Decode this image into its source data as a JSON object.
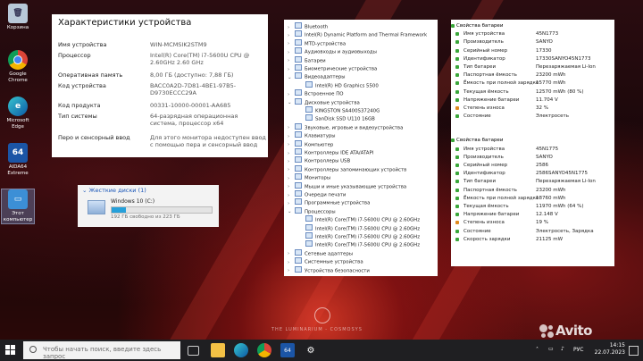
{
  "desktop": {
    "icons": [
      {
        "label": "Корзина"
      },
      {
        "label": "Google Chrome"
      },
      {
        "label": "Microsoft Edge"
      },
      {
        "label": "AIDA64 Extreme"
      },
      {
        "label": "Этот компьютер"
      }
    ],
    "wallpaper_caption": "THE LUMINARIUM - COSMOSYS"
  },
  "device_info": {
    "title": "Характеристики устройства",
    "rows": [
      {
        "key": "Имя устройства",
        "value": "WIN-MCMSIK2STM9"
      },
      {
        "key": "Процессор",
        "value": "Intel(R) Core(TM) i7-5600U CPU @ 2.60GHz   2.60 GHz"
      },
      {
        "key": "Оперативная память",
        "value": "8,00 ГБ (доступно: 7,88 ГБ)"
      },
      {
        "key": "Код устройства",
        "value": "BACC0A2D-7D81-4BE1-97B5-D9730ECCC29A"
      },
      {
        "key": "Код продукта",
        "value": "00331-10000-00001-AA685"
      },
      {
        "key": "Тип системы",
        "value": "64-разрядная операционная система, процессор x64"
      },
      {
        "key": "Перо и сенсорный ввод",
        "value": "Для этого монитора недоступен ввод с помощью пера и сенсорный ввод"
      }
    ]
  },
  "drives": {
    "header": "Жесткие диски (1)",
    "drive_name": "Windows 10 (C:)",
    "free_text": "192 ГБ свободно из 223 ГБ",
    "used_fraction": 0.14
  },
  "device_manager": {
    "items": [
      {
        "label": "Bluetooth",
        "level": 0
      },
      {
        "label": "Intel(R) Dynamic Platform and Thermal Framework",
        "level": 0
      },
      {
        "label": "MTD-устройства",
        "level": 0
      },
      {
        "label": "Аудиовходы и аудиовыходы",
        "level": 0
      },
      {
        "label": "Батареи",
        "level": 0
      },
      {
        "label": "Биометрические устройства",
        "level": 0
      },
      {
        "label": "Видеоадаптеры",
        "level": 0,
        "expanded": true
      },
      {
        "label": "Intel(R) HD Graphics 5500",
        "level": 1
      },
      {
        "label": "Встроенное ПО",
        "level": 0
      },
      {
        "label": "Дисковые устройства",
        "level": 0,
        "expanded": true
      },
      {
        "label": "KINGSTON SA400S37240G",
        "level": 1
      },
      {
        "label": "SanDisk SSD U110 16GB",
        "level": 1
      },
      {
        "label": "Звуковые, игровые и видеоустройства",
        "level": 0
      },
      {
        "label": "Клавиатуры",
        "level": 0
      },
      {
        "label": "Компьютер",
        "level": 0
      },
      {
        "label": "Контроллеры IDE ATA/ATAPI",
        "level": 0
      },
      {
        "label": "Контроллеры USB",
        "level": 0
      },
      {
        "label": "Контроллеры запоминающих устройств",
        "level": 0
      },
      {
        "label": "Мониторы",
        "level": 0
      },
      {
        "label": "Мыши и иные указывающие устройства",
        "level": 0
      },
      {
        "label": "Очереди печати",
        "level": 0
      },
      {
        "label": "Программные устройства",
        "level": 0
      },
      {
        "label": "Процессоры",
        "level": 0,
        "expanded": true
      },
      {
        "label": "Intel(R) Core(TM) i7-5600U CPU @ 2.60GHz",
        "level": 1
      },
      {
        "label": "Intel(R) Core(TM) i7-5600U CPU @ 2.60GHz",
        "level": 1
      },
      {
        "label": "Intel(R) Core(TM) i7-5600U CPU @ 2.60GHz",
        "level": 1
      },
      {
        "label": "Intel(R) Core(TM) i7-5600U CPU @ 2.60GHz",
        "level": 1
      },
      {
        "label": "Сетевые адаптеры",
        "level": 0
      },
      {
        "label": "Системные устройства",
        "level": 0
      },
      {
        "label": "Устройства безопасности",
        "level": 0
      }
    ]
  },
  "battery": {
    "groups": [
      {
        "header": "Свойства батареи",
        "rows": [
          {
            "key": "Имя устройства",
            "value": "45N1773"
          },
          {
            "key": "Производитель",
            "value": "SANYO"
          },
          {
            "key": "Серийный номер",
            "value": "17330"
          },
          {
            "key": "Идентификатор",
            "value": "17330SANYO45N1773"
          },
          {
            "key": "Тип батареи",
            "value": "Перезаряжаемая Li-Ion"
          },
          {
            "key": "Паспортная ёмкость",
            "value": "23200 mWh"
          },
          {
            "key": "Ёмкость при полной зарядке",
            "value": "15770 mWh"
          },
          {
            "key": "Текущая ёмкость",
            "value": "12570 mWh  (80 %)"
          },
          {
            "key": "Напряжение батареи",
            "value": "11.704 V"
          },
          {
            "key": "Степень износа",
            "value": "32 %",
            "warn": true
          },
          {
            "key": "Состояние",
            "value": "Электросеть"
          }
        ]
      },
      {
        "header": "Свойства батареи",
        "rows": [
          {
            "key": "Имя устройства",
            "value": "45N1775"
          },
          {
            "key": "Производитель",
            "value": "SANYO"
          },
          {
            "key": "Серийный номер",
            "value": "2586"
          },
          {
            "key": "Идентификатор",
            "value": "2586SANYO45N1775"
          },
          {
            "key": "Тип батареи",
            "value": "Перезаряжаемая Li-Ion"
          },
          {
            "key": "Паспортная ёмкость",
            "value": "23200 mWh"
          },
          {
            "key": "Ёмкость при полной зарядке",
            "value": "18760 mWh"
          },
          {
            "key": "Текущая ёмкость",
            "value": "11970 mWh  (64 %)"
          },
          {
            "key": "Напряжение батареи",
            "value": "12.148 V"
          },
          {
            "key": "Степень износа",
            "value": "19 %",
            "warn": true
          },
          {
            "key": "Состояние",
            "value": "Электросеть, Зарядка"
          },
          {
            "key": "Скорость зарядки",
            "value": "21125 mW"
          }
        ]
      }
    ]
  },
  "taskbar": {
    "search_placeholder": "Чтобы начать поиск, введите здесь запрос",
    "language": "РУС",
    "time": "14:15",
    "date": "22.07.2023"
  },
  "watermark": "Avito"
}
